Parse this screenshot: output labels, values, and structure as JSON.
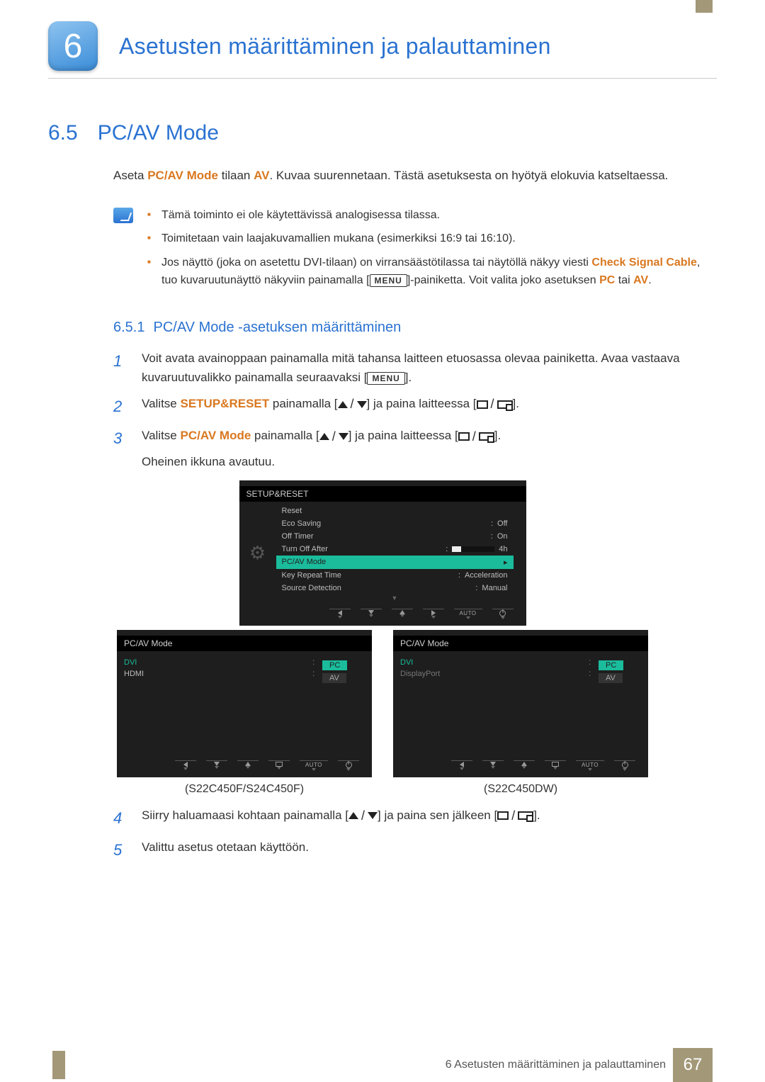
{
  "header": {
    "chapter_number": "6",
    "chapter_title": "Asetusten määrittäminen ja palauttaminen"
  },
  "section": {
    "num": "6.5",
    "title": "PC/AV Mode"
  },
  "intro": {
    "pre": "Aseta ",
    "kw1": "PC/AV Mode",
    "mid1": " tilaan ",
    "kw2": "AV",
    "rest": ". Kuvaa suurennetaan. Tästä asetuksesta on hyötyä elokuvia katseltaessa."
  },
  "notes": {
    "b1": "Tämä toiminto ei ole käytettävissä analogisessa tilassa.",
    "b2": "Toimitetaan vain laajakuvamallien mukana (esimerkiksi 16:9 tai 16:10).",
    "b3_pre": "Jos näyttö (joka on asetettu DVI-tilaan) on virransäästötilassa tai näytöllä näkyy viesti ",
    "b3_kw1": "Check Signal Cable",
    "b3_mid1": ", tuo kuvaruutunäyttö näkyviin painamalla [",
    "b3_menu": "MENU",
    "b3_mid2": "]-painiketta. Voit valita joko asetuksen ",
    "b3_kw2": "PC",
    "b3_mid3": " tai ",
    "b3_kw3": "AV",
    "b3_end": "."
  },
  "subsection": {
    "num": "6.5.1",
    "title": "PC/AV Mode -asetuksen määrittäminen"
  },
  "steps": {
    "s1a": "Voit avata avainoppaan painamalla mitä tahansa laitteen etuosassa olevaa painiketta. Avaa vastaava kuvaruutuvalikko painamalla seuraavaksi [",
    "s1_menu": "MENU",
    "s1b": "].",
    "s2a": "Valitse ",
    "s2_kw": "SETUP&RESET",
    "s2b": " painamalla [",
    "s2c": "] ja paina laitteessa [",
    "s2d": "].",
    "s3a": "Valitse ",
    "s3_kw": "PC/AV Mode",
    "s3b": " painamalla [",
    "s3c": "] ja paina laitteessa [",
    "s3d": "].",
    "s3_extra": "Oheinen ikkuna avautuu.",
    "s4a": "Siirry haluamaasi kohtaan painamalla [",
    "s4b": "] ja paina sen jälkeen [",
    "s4c": "].",
    "s5": "Valittu asetus otetaan käyttöön."
  },
  "osd_setup": {
    "title": "SETUP&RESET",
    "rows": {
      "reset": "Reset",
      "eco": "Eco Saving",
      "eco_v": "Off",
      "offtimer": "Off Timer",
      "offtimer_v": "On",
      "turnoff": "Turn Off After",
      "turnoff_v": "4h",
      "pcav": "PC/AV Mode",
      "keyrepeat": "Key Repeat Time",
      "keyrepeat_v": "Acceleration",
      "srcdet": "Source Detection",
      "srcdet_v": "Manual"
    },
    "nav_auto": "AUTO"
  },
  "osd_pcav": {
    "title": "PC/AV Mode",
    "dvi": "DVI",
    "hdmi": "HDMI",
    "displayport": "DisplayPort",
    "pc": "PC",
    "av": "AV",
    "nav_auto": "AUTO"
  },
  "captions": {
    "left": "(S22C450F/S24C450F)",
    "right": "(S22C450DW)"
  },
  "footer": {
    "chapter": "6 Asetusten määrittäminen ja palauttaminen",
    "page": "67"
  }
}
